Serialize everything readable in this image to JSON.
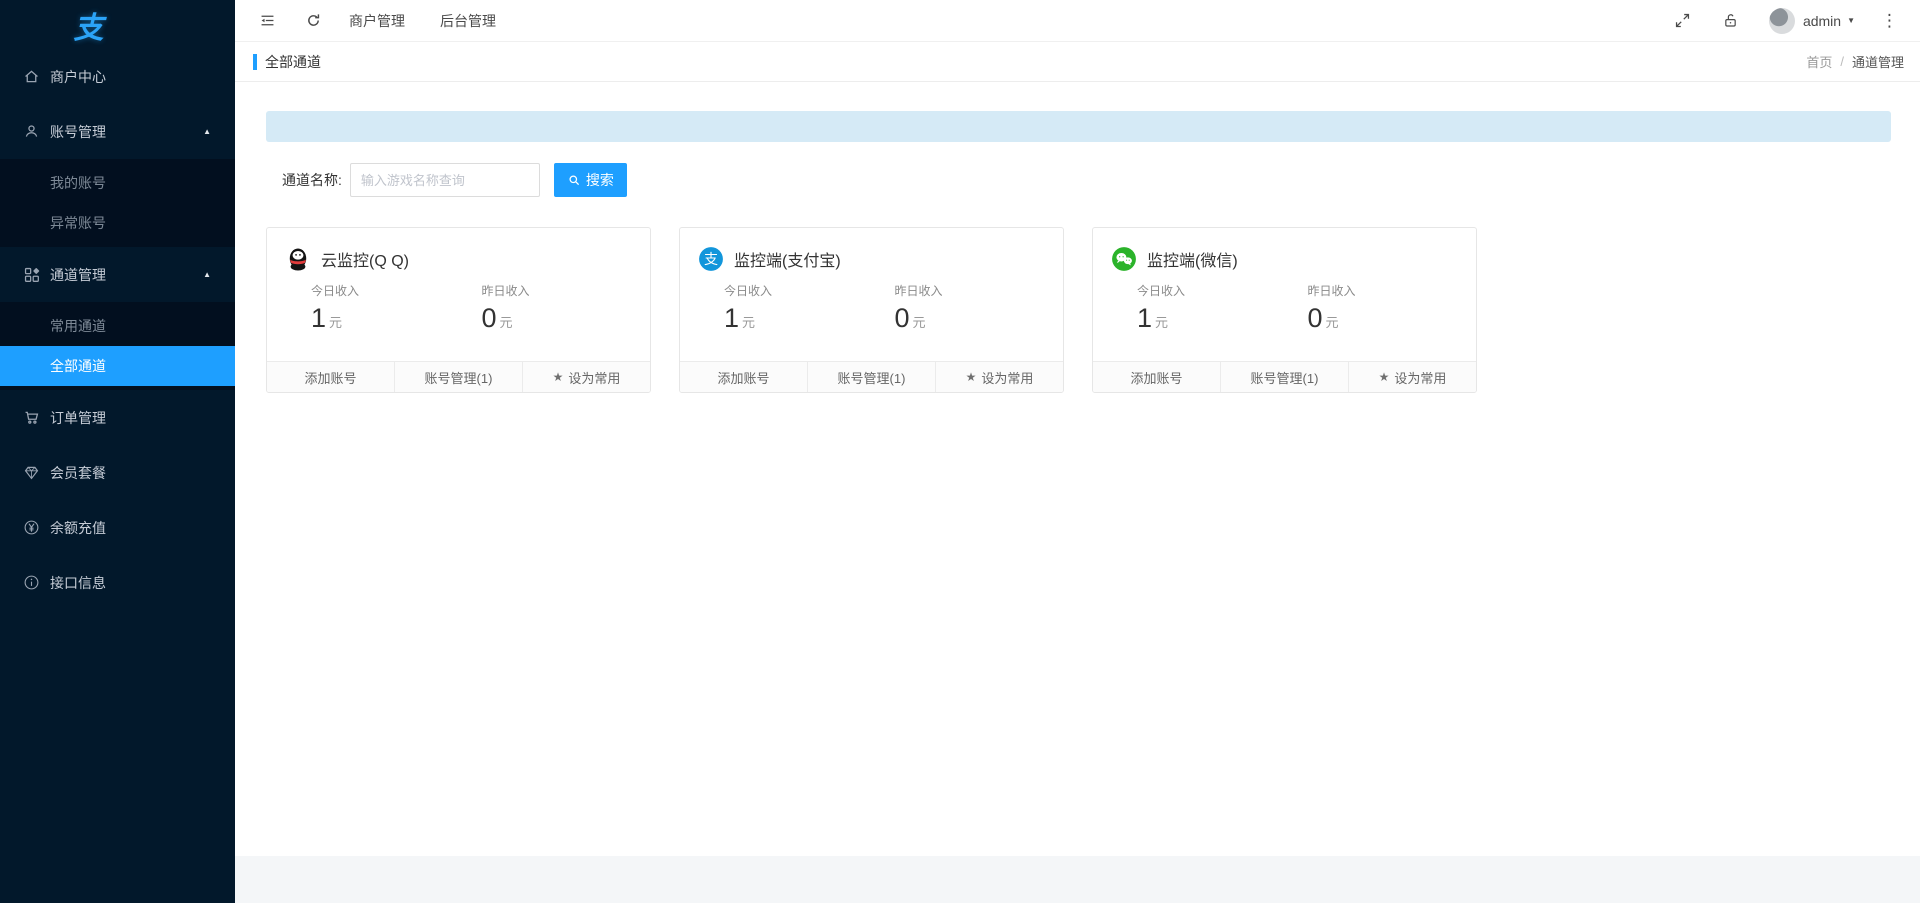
{
  "colors": {
    "accent": "#1E9FFF",
    "sidebar_bg": "#02182B",
    "submenu_bg": "#020F1F",
    "banner_bg": "#D5EAF6",
    "qq_black": "#141414",
    "qq_scarf_red": "#E23C3C",
    "alipay_blue": "#1296DB",
    "wechat_green": "#2BB32A"
  },
  "sidebar": {
    "logo": "支",
    "items": [
      {
        "label": "商户中心",
        "icon": "home-icon"
      },
      {
        "label": "账号管理",
        "icon": "user-icon",
        "expanded": true,
        "children": [
          "我的账号",
          "异常账号"
        ]
      },
      {
        "label": "通道管理",
        "icon": "component-icon",
        "expanded": true,
        "children": [
          "常用通道",
          "全部通道"
        ]
      },
      {
        "label": "订单管理",
        "icon": "cart-icon"
      },
      {
        "label": "会员套餐",
        "icon": "gem-icon"
      },
      {
        "label": "余额充值",
        "icon": "yen-icon"
      },
      {
        "label": "接口信息",
        "icon": "info-icon"
      }
    ],
    "active_item": "全部通道"
  },
  "navbar": {
    "tabs": [
      {
        "label": "商户管理"
      },
      {
        "label": "后台管理"
      }
    ],
    "user": "admin",
    "more_glyph": "⋮",
    "caret_glyph": "▼",
    "arrow_up_glyph": "▲"
  },
  "pageheader": {
    "title": "全部通道",
    "breadcrumb_home": "首页",
    "breadcrumb_sep": "/",
    "breadcrumb_current": "通道管理"
  },
  "search": {
    "label": "通道名称:",
    "placeholder": "输入游戏名称查询",
    "button": "搜索"
  },
  "cards": [
    {
      "title": "云监控(Q Q)",
      "icon": "qq-icon",
      "today_label": "今日收入",
      "today_value": "1",
      "yesterday_label": "昨日收入",
      "yesterday_value": "0",
      "unit": "元",
      "actions": [
        "添加账号",
        "账号管理(1)",
        "设为常用"
      ],
      "star_glyph": "★"
    },
    {
      "title": "监控端(支付宝)",
      "icon": "alipay-icon",
      "today_label": "今日收入",
      "today_value": "1",
      "yesterday_label": "昨日收入",
      "yesterday_value": "0",
      "unit": "元",
      "actions": [
        "添加账号",
        "账号管理(1)",
        "设为常用"
      ],
      "star_glyph": "★"
    },
    {
      "title": "监控端(微信)",
      "icon": "wechat-icon",
      "today_label": "今日收入",
      "today_value": "1",
      "yesterday_label": "昨日收入",
      "yesterday_value": "0",
      "unit": "元",
      "actions": [
        "添加账号",
        "账号管理(1)",
        "设为常用"
      ],
      "star_glyph": "★"
    }
  ]
}
